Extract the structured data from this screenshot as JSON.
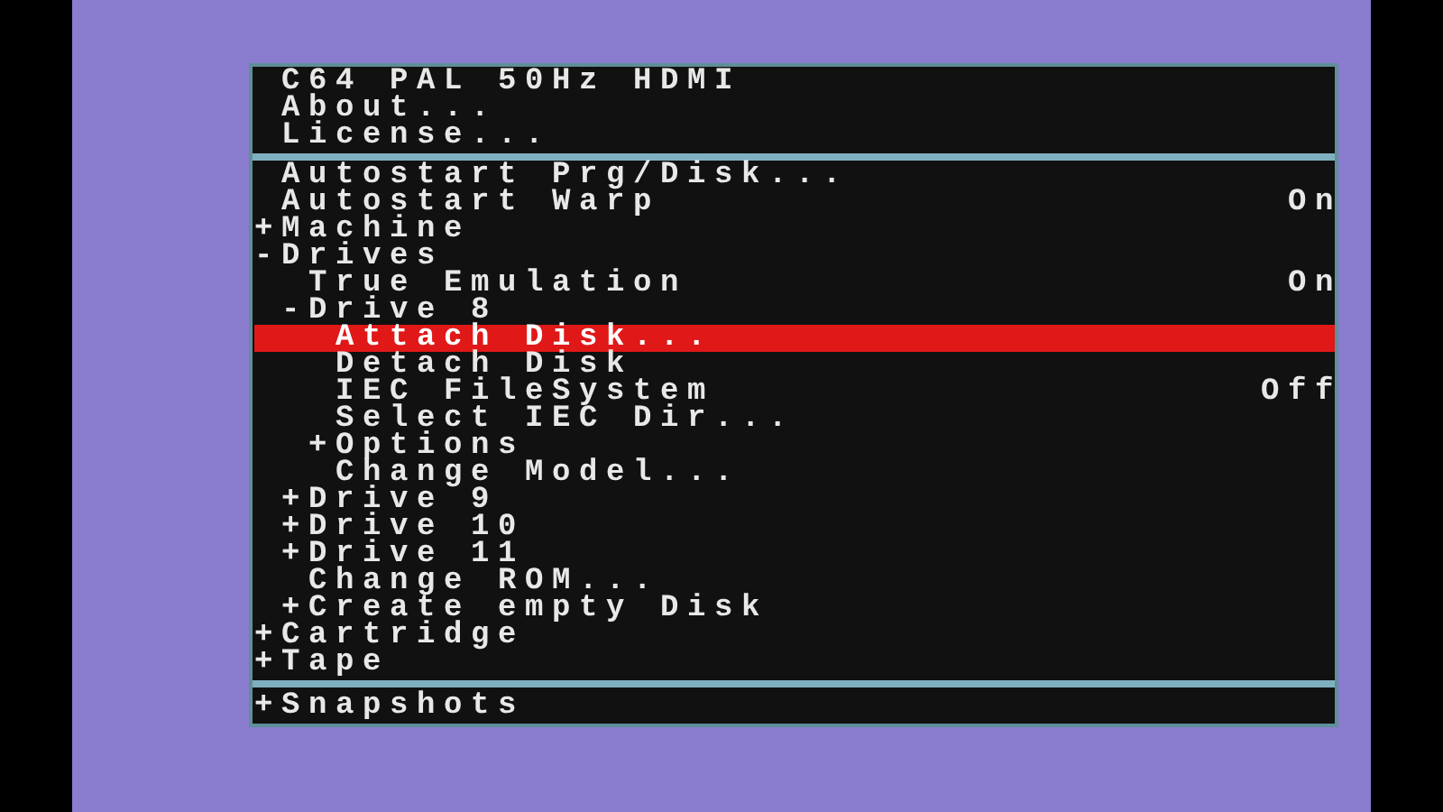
{
  "header": {
    "items": [
      {
        "kind": "action",
        "label": "C64 PAL 50Hz HDMI",
        "selected": false
      },
      {
        "kind": "action",
        "label": "About...",
        "selected": false
      },
      {
        "kind": "action",
        "label": "License...",
        "selected": false
      }
    ]
  },
  "menu": {
    "items": [
      {
        "kind": "action",
        "label": "Autostart Prg/Disk...",
        "selected": false
      },
      {
        "kind": "action",
        "label": "Autostart Warp",
        "value": "On",
        "selected": false
      },
      {
        "kind": "folder",
        "label": "+Machine",
        "selected": false
      },
      {
        "kind": "folder",
        "label": "-Drives",
        "selected": false,
        "children": [
          {
            "kind": "action",
            "label": "True Emulation",
            "value": "On",
            "selected": false
          },
          {
            "kind": "folder",
            "label": "-Drive 8",
            "selected": false,
            "children": [
              {
                "kind": "action",
                "label": "Attach Disk...",
                "selected": true
              },
              {
                "kind": "action",
                "label": "Detach Disk",
                "selected": false
              },
              {
                "kind": "action",
                "label": "IEC FileSystem",
                "value": "Off",
                "selected": false
              },
              {
                "kind": "action",
                "label": "Select IEC Dir...",
                "selected": false
              },
              {
                "kind": "folder",
                "label": "+Options",
                "selected": false
              },
              {
                "kind": "action",
                "label": "Change Model...",
                "selected": false
              }
            ]
          },
          {
            "kind": "folder",
            "label": "+Drive 9",
            "selected": false
          },
          {
            "kind": "folder",
            "label": "+Drive 10",
            "selected": false
          },
          {
            "kind": "folder",
            "label": "+Drive 11",
            "selected": false
          },
          {
            "kind": "action",
            "label": "Change ROM...",
            "selected": false
          },
          {
            "kind": "folder",
            "label": "+Create empty Disk",
            "selected": false
          }
        ]
      },
      {
        "kind": "folder",
        "label": "+Cartridge",
        "selected": false
      },
      {
        "kind": "folder",
        "label": "+Tape",
        "selected": false
      }
    ]
  },
  "footer": {
    "items": [
      {
        "kind": "folder",
        "label": "+Snapshots",
        "selected": false
      }
    ]
  }
}
